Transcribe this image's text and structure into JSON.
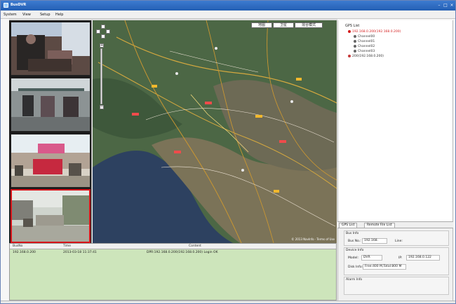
{
  "window": {
    "title": "BusDVR"
  },
  "menu": [
    "System",
    "View",
    "Setup",
    "Help"
  ],
  "map": {
    "toolbar": [
      "地图",
      "卫星",
      "混合模式"
    ],
    "copyright": "© 2013 NavInfo · Terms of Use"
  },
  "video_feeds": [
    "Camera 1",
    "Camera 2",
    "Camera 3",
    "Camera 4"
  ],
  "gps_list": {
    "title": "GPS List",
    "root": "192.168.0.200(192.168.0.200)",
    "channels": [
      "Channel00",
      "Channel01",
      "Channel02",
      "Channel03"
    ],
    "second": "200(192.168.0.200)"
  },
  "tabs": [
    "GPS List",
    "Remote File List"
  ],
  "bus_info": {
    "title": "Bus Info",
    "bus_no_label": "Bus No.:",
    "bus_no": "192.168.",
    "line_label": "Line:",
    "device_title": "Device Info",
    "model_label": "Model:",
    "model": "DVR",
    "ip_label": "IP:",
    "ip": "192.168.0.122",
    "disk_label": "Disk Info:",
    "disk": "Free:400 M,Total:800 M",
    "alarm_title": "Alarm Info"
  },
  "log": {
    "headers": [
      "BusNo",
      "Time",
      "Content"
    ],
    "row": [
      "192.168.0.200",
      "2013-03-18 11:37:41",
      "DPR:192.168.0.200(192.168.0.200) Login OK"
    ]
  }
}
